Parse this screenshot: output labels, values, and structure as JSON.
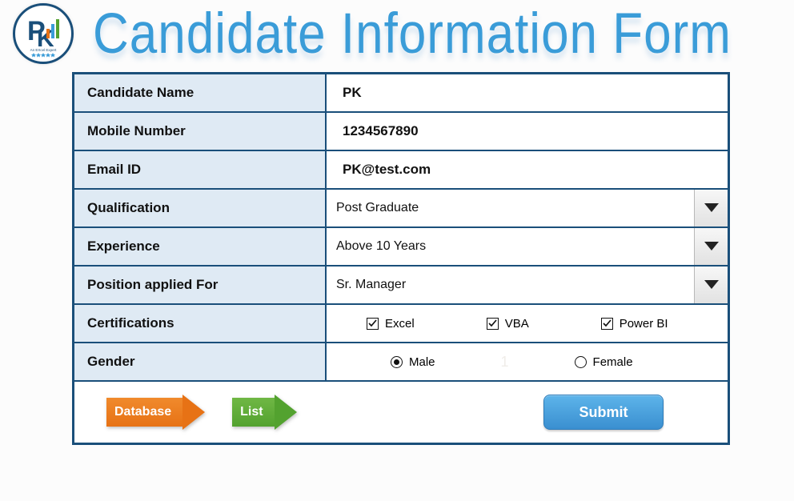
{
  "header": {
    "title": "Candidate Information Form",
    "logo_alt": "PK An Excel Expert"
  },
  "form": {
    "fields": [
      {
        "label": "Candidate Name",
        "value": "PK",
        "type": "text"
      },
      {
        "label": "Mobile Number",
        "value": "1234567890",
        "type": "text"
      },
      {
        "label": "Email ID",
        "value": "PK@test.com",
        "type": "text"
      },
      {
        "label": "Qualification",
        "value": "Post Graduate",
        "type": "select"
      },
      {
        "label": "Experience",
        "value": "Above 10 Years",
        "type": "select"
      },
      {
        "label": "Position applied For",
        "value": "Sr. Manager",
        "type": "select"
      }
    ],
    "certifications": {
      "label": "Certifications",
      "options": [
        {
          "label": "Excel",
          "checked": true
        },
        {
          "label": "VBA",
          "checked": true
        },
        {
          "label": "Power BI",
          "checked": true
        }
      ]
    },
    "gender": {
      "label": "Gender",
      "ghost_value": "1",
      "options": [
        {
          "label": "Male",
          "selected": true
        },
        {
          "label": "Female",
          "selected": false
        }
      ]
    }
  },
  "footer": {
    "database_label": "Database",
    "list_label": "List",
    "submit_label": "Submit"
  },
  "colors": {
    "frame": "#1a4f7a",
    "label_bg": "#dfeaf4",
    "title": "#3a9cd8",
    "orange": "#e77215",
    "green": "#53a22f",
    "submit": "#3a8fd0"
  }
}
